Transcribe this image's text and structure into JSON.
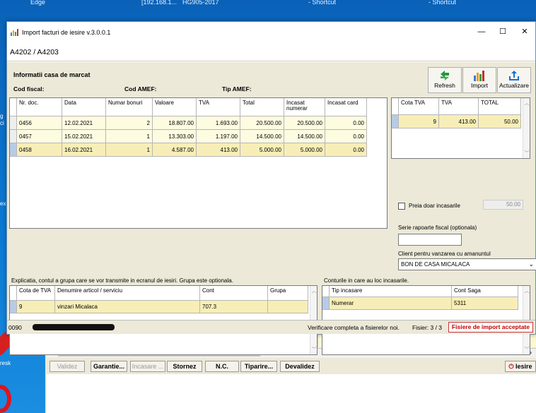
{
  "desktop": {
    "top_labels": [
      "Edge",
      "[192.168.1...",
      "HG905-2017",
      "- Shortcut",
      "- Shortcut"
    ],
    "left_labels": [
      "g",
      "ci",
      "ex",
      "resk"
    ]
  },
  "window": {
    "title": "Import facturi de iesire v.3.0.0.1",
    "minimize": "—",
    "maximize": "☐",
    "close": "✕",
    "tab_code": "A4202 / A4203"
  },
  "info": {
    "section_title": "Informatii casa de marcat",
    "cod_fiscal_label": "Cod fiscal:",
    "cod_amef_label": "Cod AMEF:",
    "tip_amef_label": "Tip AMEF:"
  },
  "toolbar": {
    "refresh_label": "Refresh",
    "import_label": "Import",
    "actualizare_label": "Actualizare"
  },
  "docs_table": {
    "columns": [
      "Nr. doc.",
      "Data",
      "Numar bonuri",
      "Valoare",
      "TVA",
      "Total",
      "Incasat numerar",
      "Incasat card"
    ],
    "rows": [
      [
        "0456",
        "12.02.2021",
        "2",
        "18.807.00",
        "1.693.00",
        "20.500.00",
        "20.500.00",
        "0.00"
      ],
      [
        "0457",
        "15.02.2021",
        "1",
        "13.303.00",
        "1.197.00",
        "14.500.00",
        "14.500.00",
        "0.00"
      ],
      [
        "0458",
        "16.02.2021",
        "1",
        "4.587.00",
        "413.00",
        "5.000.00",
        "5.000.00",
        "0.00"
      ]
    ]
  },
  "tva_table": {
    "columns": [
      "Cota TVA",
      "TVA",
      "TOTAL"
    ],
    "rows": [
      [
        "9",
        "413.00",
        "50.00"
      ]
    ]
  },
  "right_panel": {
    "preia_label": "Preia doar incasarile",
    "preia_value": "50.00",
    "serie_label": "Serie rapoarte fiscal (optionala)",
    "serie_value": "",
    "client_label": "Client pentru vanzarea cu amanuntul",
    "client_value": "BON DE CASA MICALACA"
  },
  "explicatii": {
    "label": "Explicatia, contul a grupa care se vor transmite in ecranul de iesiri. Grupa este optionala.",
    "columns": [
      "Cota de TVA",
      "Denumire articol / serviciu",
      "Cont",
      "Grupa"
    ],
    "rows": [
      [
        "9",
        "vinzari Micalaca",
        "707.3",
        ""
      ]
    ]
  },
  "conturi": {
    "label": "Conturile in care au loc incasarile.",
    "columns": [
      "Tip incasare",
      "Cont Saga"
    ],
    "rows": [
      [
        "Numerar",
        "5311"
      ]
    ]
  },
  "statusbar": {
    "code": "0090",
    "verificare": "Verificare completa a fisierelor noi.",
    "fisier": "Fisier: 3 / 3",
    "badge": "Fisiere de import acceptate"
  },
  "background_app": {
    "buttons": [
      "Validez",
      "Garantie...",
      "Incasare ...",
      "Stornez",
      "N.C.",
      "Tiparire...",
      "Devalidez",
      "Iesire"
    ]
  },
  "colors": {
    "grid_row": "#fdfbe0",
    "grid_selected": "#f7eeb7",
    "badge_red": "#b00000"
  }
}
